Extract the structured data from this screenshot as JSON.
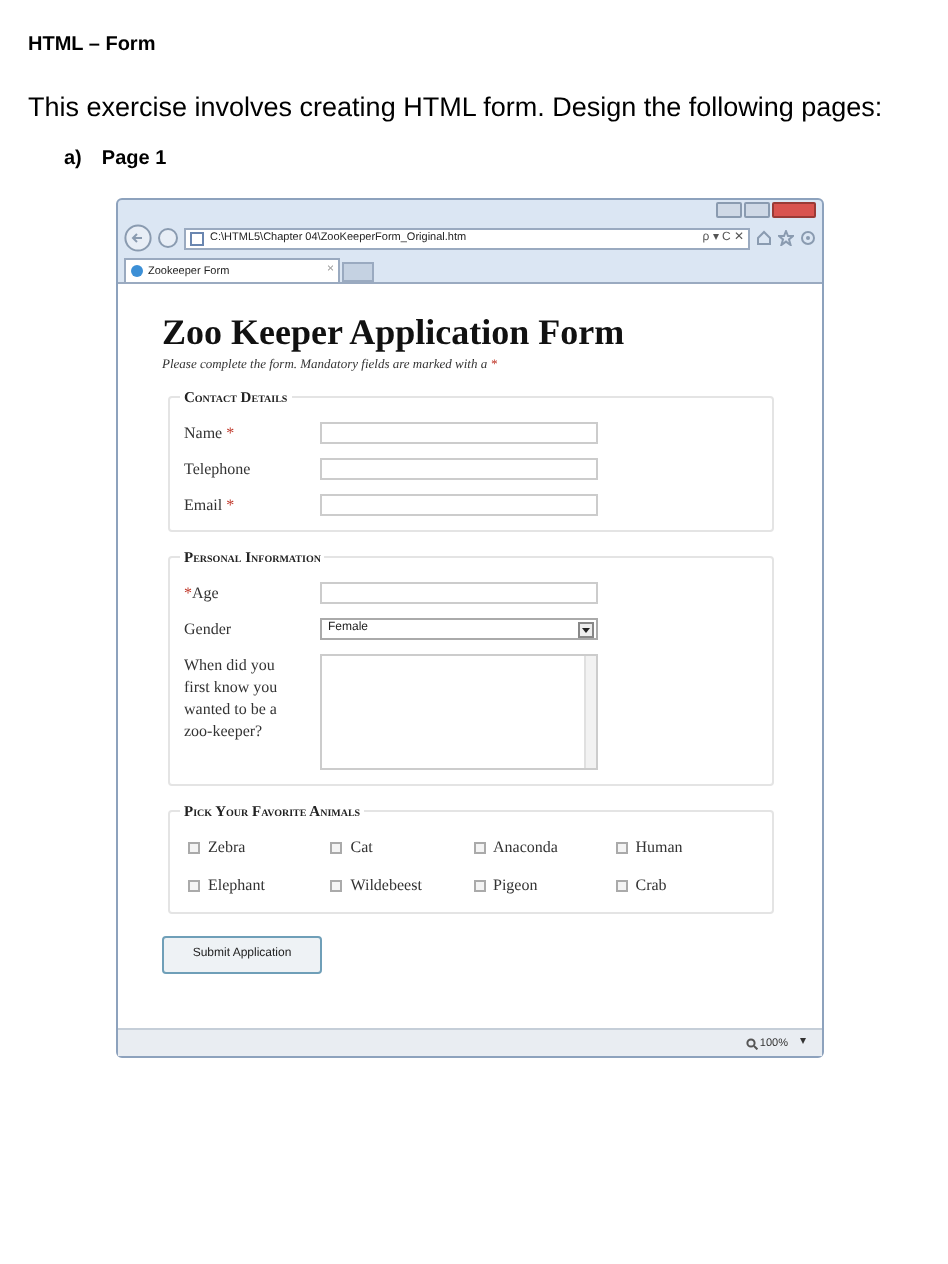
{
  "document": {
    "heading": "HTML – Form",
    "intro": "This exercise involves creating HTML form. Design the following pages:",
    "item_marker": "a)",
    "item_label": "Page 1"
  },
  "browser": {
    "address": "C:\\HTML5\\Chapter 04\\ZooKeeperForm_Original.htm",
    "address_controls": "ρ ▾ C ✕",
    "tab": {
      "title": "Zookeeper Form",
      "close": "×",
      "selected": true
    },
    "zoom": "100%",
    "zoom_caret": "▾"
  },
  "form": {
    "title": "Zoo Keeper Application Form",
    "subtitle": "Please complete the form. Mandatory fields are marked with a",
    "required_mark": "*",
    "sections": [
      {
        "legend": "Contact Details",
        "kind": "fields",
        "fields": [
          {
            "label": "Name",
            "required": true,
            "mark_first": false,
            "kind": "text"
          },
          {
            "label": "Telephone",
            "required": false,
            "kind": "text"
          },
          {
            "label": "Email",
            "required": true,
            "mark_first": false,
            "kind": "text"
          }
        ]
      },
      {
        "legend": "Personal Information",
        "kind": "fields",
        "fields": [
          {
            "label": "Age",
            "required": true,
            "mark_first": true,
            "kind": "text"
          },
          {
            "label": "Gender",
            "required": false,
            "kind": "select",
            "value": "Female"
          },
          {
            "label": "When did you first know you wanted to be a zoo-keeper?",
            "required": false,
            "kind": "textarea"
          }
        ]
      },
      {
        "legend": "Pick Your Favorite Animals",
        "kind": "checkboxes",
        "options": [
          {
            "label": "Zebra",
            "checked": false
          },
          {
            "label": "Cat",
            "checked": false
          },
          {
            "label": "Anaconda",
            "checked": false
          },
          {
            "label": "Human",
            "checked": false
          },
          {
            "label": "Elephant",
            "checked": false
          },
          {
            "label": "Wildebeest",
            "checked": false
          },
          {
            "label": "Pigeon",
            "checked": false
          },
          {
            "label": "Crab",
            "checked": false
          }
        ]
      }
    ],
    "submit": "Submit Application"
  }
}
